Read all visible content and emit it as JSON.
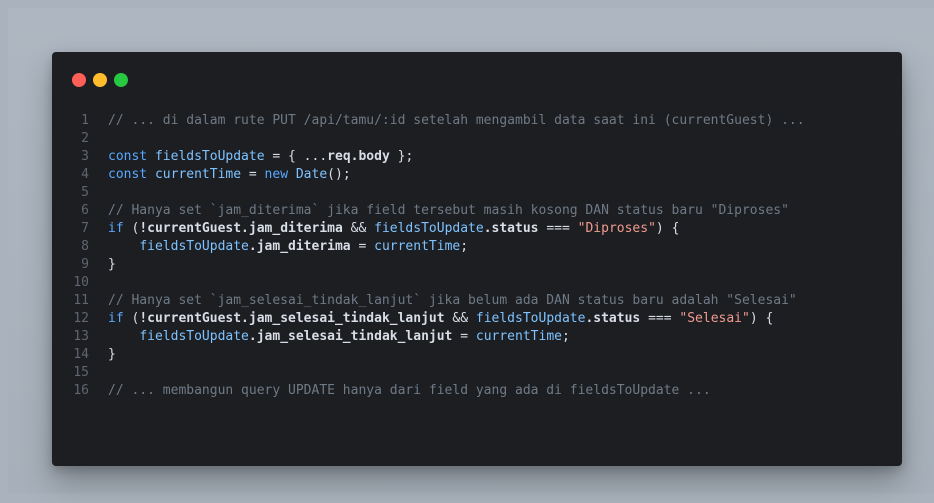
{
  "window": {
    "controls": {
      "close": "#ff5f57",
      "minimize": "#ffbd2e",
      "maximize": "#28c840"
    }
  },
  "code": {
    "lines": [
      {
        "number": "1",
        "tokens": [
          {
            "text": "// ... di dalam rute PUT /api/tamu/:id setelah mengambil data saat ini (currentGuest) ...",
            "type": "comment"
          }
        ]
      },
      {
        "number": "2",
        "tokens": []
      },
      {
        "number": "3",
        "tokens": [
          {
            "text": "const ",
            "type": "keyword"
          },
          {
            "text": "fieldsToUpdate",
            "type": "variable"
          },
          {
            "text": " = ",
            "type": "plain"
          },
          {
            "text": "{",
            "type": "plain"
          },
          {
            "text": " ...",
            "type": "plain"
          },
          {
            "text": "req.body",
            "type": "bold-plain"
          },
          {
            "text": " };",
            "type": "plain"
          }
        ]
      },
      {
        "number": "4",
        "tokens": [
          {
            "text": "const ",
            "type": "keyword"
          },
          {
            "text": "currentTime",
            "type": "variable"
          },
          {
            "text": " = ",
            "type": "plain"
          },
          {
            "text": "new ",
            "type": "keyword"
          },
          {
            "text": "Date",
            "type": "function"
          },
          {
            "text": "();",
            "type": "plain"
          }
        ]
      },
      {
        "number": "5",
        "tokens": []
      },
      {
        "number": "6",
        "tokens": [
          {
            "text": "// Hanya set `jam_diterima` jika field tersebut masih kosong DAN status baru \"Diproses\"",
            "type": "comment"
          }
        ]
      },
      {
        "number": "7",
        "tokens": [
          {
            "text": "if ",
            "type": "keyword"
          },
          {
            "text": "(",
            "type": "plain"
          },
          {
            "text": "!currentGuest.jam_diterima",
            "type": "bold-plain"
          },
          {
            "text": " && ",
            "type": "plain"
          },
          {
            "text": "fieldsToUpdate",
            "type": "variable"
          },
          {
            "text": ".status",
            "type": "bold-plain"
          },
          {
            "text": " === ",
            "type": "plain"
          },
          {
            "text": "\"Diproses\"",
            "type": "string"
          },
          {
            "text": ") {",
            "type": "plain"
          }
        ]
      },
      {
        "number": "8",
        "tokens": [
          {
            "text": "    ",
            "type": "plain"
          },
          {
            "text": "fieldsToUpdate",
            "type": "variable"
          },
          {
            "text": ".jam_diterima",
            "type": "bold-plain"
          },
          {
            "text": " = ",
            "type": "plain"
          },
          {
            "text": "currentTime",
            "type": "variable"
          },
          {
            "text": ";",
            "type": "plain"
          }
        ]
      },
      {
        "number": "9",
        "tokens": [
          {
            "text": "}",
            "type": "plain"
          }
        ]
      },
      {
        "number": "10",
        "tokens": []
      },
      {
        "number": "11",
        "tokens": [
          {
            "text": "// Hanya set `jam_selesai_tindak_lanjut` jika belum ada DAN status baru adalah \"Selesai\"",
            "type": "comment"
          }
        ]
      },
      {
        "number": "12",
        "tokens": [
          {
            "text": "if ",
            "type": "keyword"
          },
          {
            "text": "(",
            "type": "plain"
          },
          {
            "text": "!currentGuest.jam_selesai_tindak_lanjut",
            "type": "bold-plain"
          },
          {
            "text": " && ",
            "type": "plain"
          },
          {
            "text": "fieldsToUpdate",
            "type": "variable"
          },
          {
            "text": ".status",
            "type": "bold-plain"
          },
          {
            "text": " === ",
            "type": "plain"
          },
          {
            "text": "\"Selesai\"",
            "type": "string"
          },
          {
            "text": ") {",
            "type": "plain"
          }
        ]
      },
      {
        "number": "13",
        "tokens": [
          {
            "text": "    ",
            "type": "plain"
          },
          {
            "text": "fieldsToUpdate",
            "type": "variable"
          },
          {
            "text": ".jam_selesai_tindak_lanjut",
            "type": "bold-plain"
          },
          {
            "text": " = ",
            "type": "plain"
          },
          {
            "text": "currentTime",
            "type": "variable"
          },
          {
            "text": ";",
            "type": "plain"
          }
        ]
      },
      {
        "number": "14",
        "tokens": [
          {
            "text": "}",
            "type": "plain"
          }
        ]
      },
      {
        "number": "15",
        "tokens": []
      },
      {
        "number": "16",
        "tokens": [
          {
            "text": "// ... membangun query UPDATE hanya dari field yang ada di fieldsToUpdate ...",
            "type": "comment"
          }
        ]
      }
    ]
  }
}
